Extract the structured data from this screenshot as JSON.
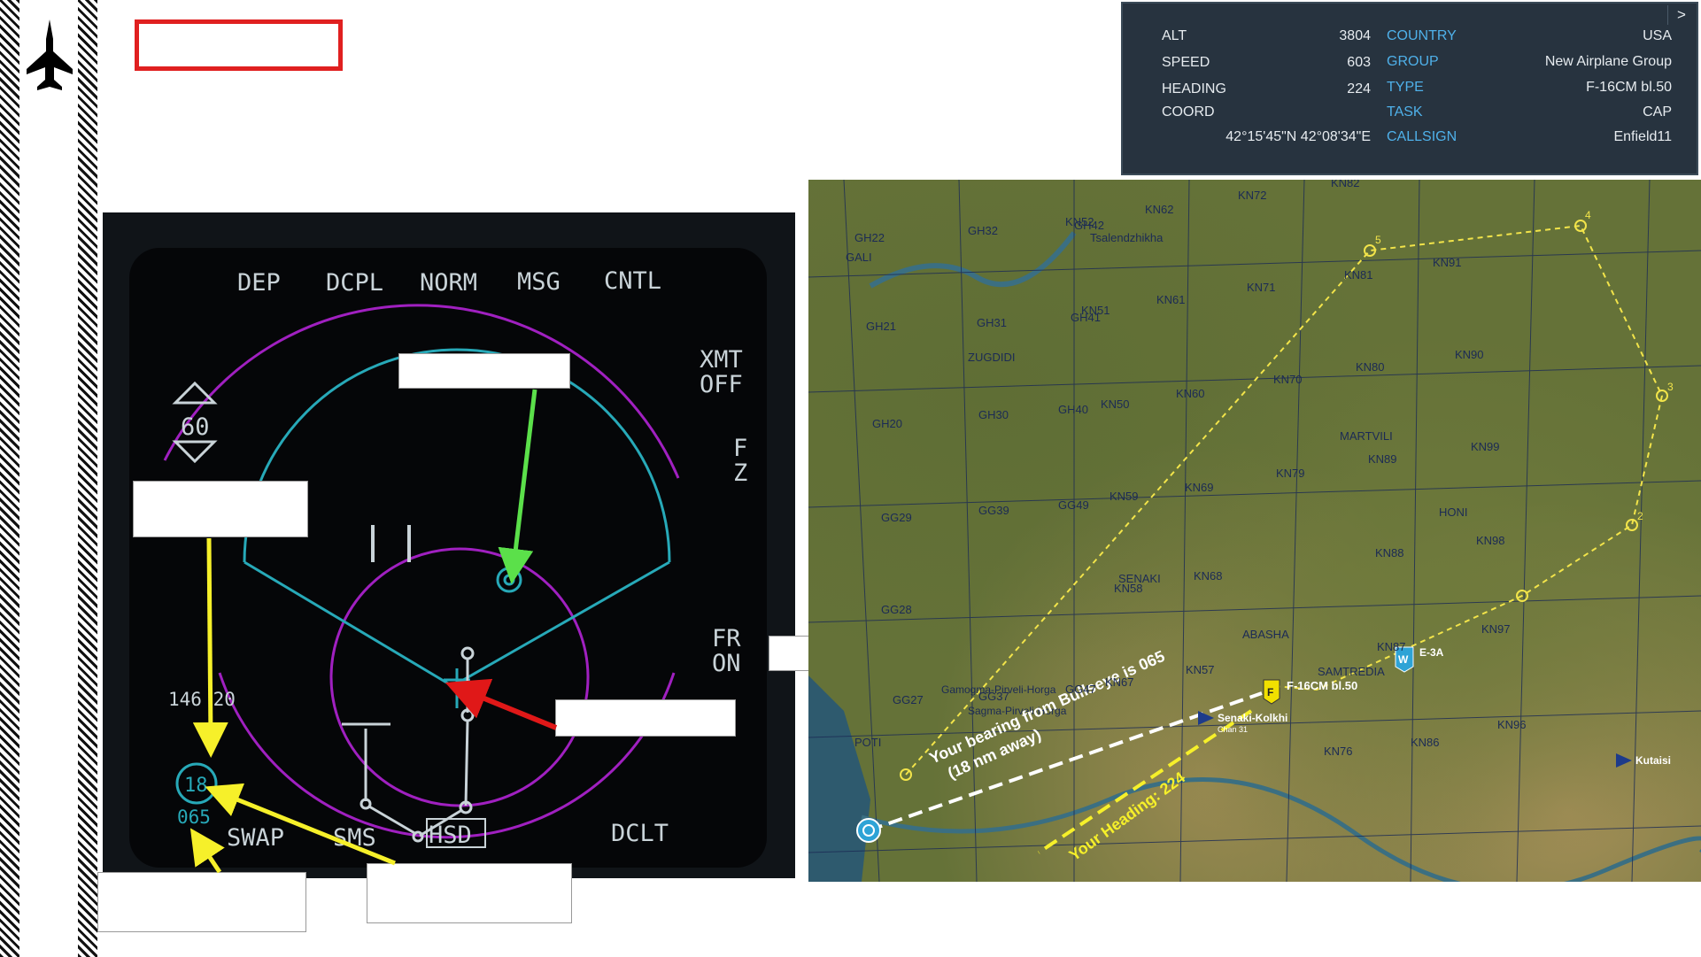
{
  "mfd": {
    "osb_top": [
      "DEP",
      "DCPL",
      "NORM",
      "MSG",
      "CNTL"
    ],
    "osb_right": [
      "XMT\nOFF",
      "F\nZ",
      "FR\nON"
    ],
    "osb_bottom": [
      "SWAP",
      "SMS",
      "HSD",
      "DCLT"
    ],
    "range": "60",
    "cursor_readout": "146 20",
    "bullseye_range": "18",
    "bullseye_bearing": "065"
  },
  "info_panel": {
    "left": [
      {
        "label": "ALT",
        "value": "3804"
      },
      {
        "label": "SPEED",
        "value": "603"
      },
      {
        "label": "HEADING",
        "value": "224"
      },
      {
        "label": "COORD",
        "value": ""
      }
    ],
    "coord_value": "42°15'45\"N 42°08'34\"E",
    "right": [
      {
        "label": "COUNTRY",
        "value": "USA"
      },
      {
        "label": "GROUP",
        "value": "New Airplane Group"
      },
      {
        "label": "TYPE",
        "value": "F-16CM bl.50"
      },
      {
        "label": "TASK",
        "value": "CAP"
      },
      {
        "label": "CALLSIGN",
        "value": "Enfield11"
      }
    ],
    "close_label": ">"
  },
  "map": {
    "grid_labels": [
      "KN72",
      "KN82",
      "KN62",
      "KN52",
      "GH22",
      "GH32",
      "GH42",
      "Tsalendzhikha",
      "GALI",
      "KN81",
      "KN91",
      "KN71",
      "KN61",
      "KN51",
      "GH21",
      "GH31",
      "GH41",
      "ZUGDIDI",
      "KN80",
      "KN90",
      "KN70",
      "KN60",
      "KN50",
      "GH20",
      "GH30",
      "GH40",
      "MARTVILI",
      "KN89",
      "KN99",
      "KN79",
      "KN69",
      "KN59",
      "GG29",
      "GG39",
      "GG49",
      "HONI",
      "KN88",
      "KN98",
      "KN68",
      "KN58",
      "SENAKI",
      "GG28",
      "ABASHA",
      "KN97",
      "KN87",
      "KN57",
      "KN67",
      "GG27",
      "GG37",
      "GG47",
      "KN96",
      "KN86",
      "KN76",
      "POTI",
      "SAMTREDIA"
    ],
    "towns": [
      "Gamogma-Pirveli-Horga",
      "Sagma-Pirveli-Horga"
    ],
    "waypoints": [
      "2",
      "3",
      "4",
      "5"
    ],
    "player_label": "F-16CM bl.50",
    "player_marker": "F",
    "awacs_label": "E-3A",
    "awacs_marker": "W",
    "airfield_1": "Senaki-Kolkhi",
    "airfield_1_sub": "Chan 31",
    "airfield_2": "Kutaisi",
    "annotation_bearing": "Your bearing from Bullseye is 065",
    "annotation_distance": "(18 nm away)",
    "annotation_heading": "Your Heading: 224"
  }
}
